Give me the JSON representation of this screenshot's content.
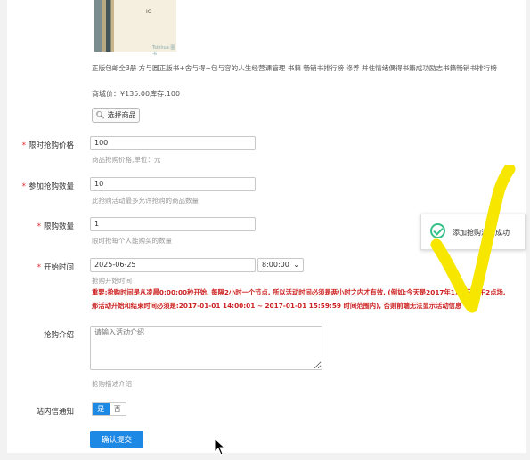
{
  "product": {
    "cover_label": "IC",
    "cover_brand": "Tsinhua 图书",
    "title": "正版包邮全3册 方与圆正版书+舍与得+包与容的人生经营课管理 书籍 畅销书排行榜 修养 并住情绪偶得书籍成功励志书籍畅销书排行榜",
    "price_text": "商城价：¥135.00库存:100",
    "select_button": "选择商品"
  },
  "form": {
    "required_mark": "*",
    "flash_price": {
      "label": "限时抢购价格",
      "value": "100",
      "help": "商品抢购价格,单位：元"
    },
    "quantity": {
      "label": "参加抢购数量",
      "value": "10",
      "help": "此抢购活动最多允许抢购的商品数量"
    },
    "limit": {
      "label": "限购数量",
      "value": "1",
      "help": "限时抢每个人能购买的数量"
    },
    "start_time": {
      "label": "开始时间",
      "date": "2025-06-25",
      "hour": "8:00:00",
      "help": "抢购开始时间",
      "warning_line1": "重要:抢购时间是从凌晨0:00:00秒开始, 每隔2小时一个节点, 所以活动时间必须是两小时之内才有效, (例如:今天是2017年1月1日下午2点场,",
      "warning_line2": "那活动开始和结束时间必须是:2017-01-01 14:00:01 ~ 2017-01-01 15:59:59 时间范围内), 否则前端无法显示活动信息"
    },
    "intro": {
      "label": "抢购介绍",
      "placeholder": "请输入活动介绍",
      "help": "抢购描述介绍"
    },
    "notify": {
      "label": "站内信通知",
      "yes": "是",
      "no": "否"
    },
    "submit": "确认提交"
  },
  "toast": {
    "message": "添加抢购活动成功"
  },
  "colors": {
    "primary": "#1e88e5",
    "required": "#e0242b",
    "warning": "#cc1f1f",
    "annotation": "#f6e600",
    "success": "#37c08a"
  }
}
